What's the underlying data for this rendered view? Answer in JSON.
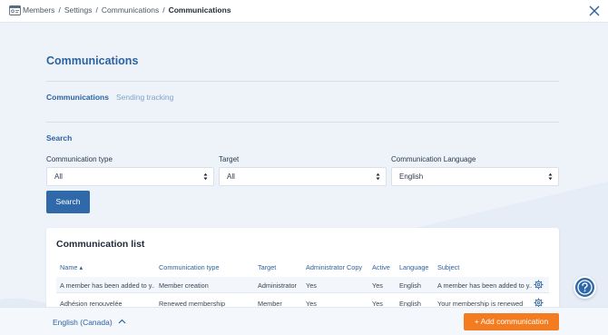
{
  "breadcrumb": {
    "items": [
      "Members",
      "Settings",
      "Communications"
    ],
    "current": "Communications",
    "separator": "/"
  },
  "page": {
    "title": "Communications"
  },
  "tabs": [
    {
      "label": "Communications",
      "active": true
    },
    {
      "label": "Sending tracking",
      "active": false
    }
  ],
  "search": {
    "section_label": "Search",
    "fields": [
      {
        "label": "Communication type",
        "value": "All"
      },
      {
        "label": "Target",
        "value": "All"
      },
      {
        "label": "Communication Language",
        "value": "English"
      }
    ],
    "button_label": "Search"
  },
  "list": {
    "title": "Communication list",
    "columns": [
      "Name ▴",
      "Communication type",
      "Target",
      "Administrator Copy",
      "Active",
      "Language",
      "Subject"
    ],
    "rows": [
      {
        "name": "A member has been added to y...",
        "type": "Member creation",
        "target": "Administrator",
        "admin_copy": "Yes",
        "active": "Yes",
        "language": "English",
        "subject": "A member has been added to y..."
      },
      {
        "name": "Adhésion renouvelée",
        "type": "Renewed membership",
        "target": "Member",
        "admin_copy": "Yes",
        "active": "Yes",
        "language": "English",
        "subject": "Your membership is renewed"
      }
    ]
  },
  "footer": {
    "language": "English (Canada)",
    "add_button": "+  Add communication"
  },
  "colors": {
    "accent": "#2f69a9",
    "primary_text": "#2d62a0",
    "cta": "#f47c20",
    "background": "#eef3fa"
  },
  "icons": {
    "breadcrumb": "id-card-icon",
    "close": "close-icon",
    "row_action": "gear-icon",
    "footer_chevron": "chevron-up-icon",
    "help": "question-icon"
  }
}
